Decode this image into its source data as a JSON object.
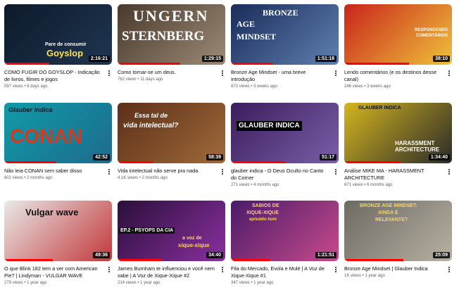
{
  "videos": [
    {
      "title": "COMO FUGIR DO GOYSLOP - Indicação de livros, filmes e jogos",
      "views": "597 views",
      "age": "9 days ago",
      "duration": "2:16:21",
      "thumb_text_1": "Pare de consumir",
      "thumb_text_2": "Goyslop",
      "colors": [
        "#0d1a2b",
        "#1f3550"
      ],
      "progress": 0.42
    },
    {
      "title": "Como tornar-se um deus.",
      "views": "762 views",
      "age": "11 days ago",
      "duration": "1:29:15",
      "thumb_text_1": "UNGERN",
      "thumb_text_2": "STERNBERG",
      "colors": [
        "#4a3a2c",
        "#9b8a76"
      ],
      "progress": 0.58
    },
    {
      "title": "Bronze Age Mindset - uma breve introdução",
      "views": "873 views",
      "age": "3 weeks ago",
      "duration": "1:51:18",
      "thumb_text_1": "BRONZE",
      "thumb_text_2": "AGE",
      "thumb_text_3": "MINDSET",
      "colors": [
        "#1a2c5a",
        "#5f80b0"
      ],
      "progress": 0.39
    },
    {
      "title": "Lendo comentários (e os destinos desse canal)",
      "views": "246 views",
      "age": "3 weeks ago",
      "duration": "38:10",
      "thumb_text_1": "RESPONDENDO",
      "thumb_text_2": "COMENTÁRIOS",
      "colors": [
        "#c9241b",
        "#efc23a"
      ],
      "progress": 0.6
    },
    {
      "title": "Não leia CONAN sem saber disso",
      "views": "602 views",
      "age": "2 months ago",
      "duration": "42:52",
      "thumb_text_1": "Glauber indica",
      "thumb_text_2": "CONAN",
      "colors": [
        "#0f9aa8",
        "#1f6b8c"
      ],
      "progress": 0.48
    },
    {
      "title": "Vida intelectual não serve pra nada",
      "views": "4.1K views",
      "age": "2 months ago",
      "duration": "58:39",
      "thumb_text_1": "Essa tal de",
      "thumb_text_2": "vida intelectual?",
      "colors": [
        "#5c2f18",
        "#a06a3a"
      ],
      "progress": 0.33
    },
    {
      "title": "glauber indica - O Deus Oculto no Canto do Corner",
      "views": "271 views",
      "age": "4 months ago",
      "duration": "51:17",
      "thumb_text_1": "GLAUBER INDICA",
      "colors": [
        "#3b1d5c",
        "#7a5fa8"
      ],
      "progress": 0.5
    },
    {
      "title": "Análise MIKE MA - HARASSMENT ARCHITECTURE",
      "views": "671 views",
      "age": "6 months ago",
      "duration": "1:34:40",
      "thumb_text_1": "GLAUBER INDICA",
      "thumb_text_2": "HARASSMENT",
      "thumb_text_3": "ARCHITECTURE",
      "colors": [
        "#d4b51e",
        "#2a2a2a"
      ],
      "progress": 0.52
    },
    {
      "title": "O que Blink 182 tem a ver com American Pie? | Lindyman - VULGAR WAVE",
      "views": "279 views",
      "age": "1 year ago",
      "duration": "49:36",
      "thumb_text_1": "Vulgar wave",
      "colors": [
        "#e9e9e9",
        "#c3383a"
      ],
      "progress": 0.45
    },
    {
      "title": "James Burnham te influenciou e você nem sabe | A Voz de Xique-Xique #2",
      "views": "214 views",
      "age": "1 year ago",
      "duration": "34:40",
      "thumb_text_1": "EP.2 - PSYOPS DA CIA",
      "thumb_text_2": "a voz de",
      "thumb_text_3": "xique-xique",
      "colors": [
        "#2a0f3a",
        "#8a2fa0"
      ],
      "progress": 0.41
    },
    {
      "title": "Fila do Mercado, Evola e Mulé | A Voz de Xique-Xique #1",
      "views": "347 views",
      "age": "1 year ago",
      "duration": "1:21:51",
      "thumb_text_1": "SABIOS DE",
      "thumb_text_2": "XIQUE-XIQUE",
      "thumb_text_3": "episódio hum",
      "colors": [
        "#4a1a6a",
        "#c84a8a"
      ],
      "progress": 0.36
    },
    {
      "title": "Bronze Age Mindset | Glauber Indica",
      "views": "1K views",
      "age": "1 year ago",
      "duration": "25:09",
      "thumb_text_1": "BRONZE AGE MINDSET:",
      "thumb_text_2": "AINDA É",
      "thumb_text_3": "RELEVANTE?",
      "colors": [
        "#6d6a63",
        "#b7b0a2"
      ],
      "progress": 0.55
    }
  ],
  "separator": " • "
}
